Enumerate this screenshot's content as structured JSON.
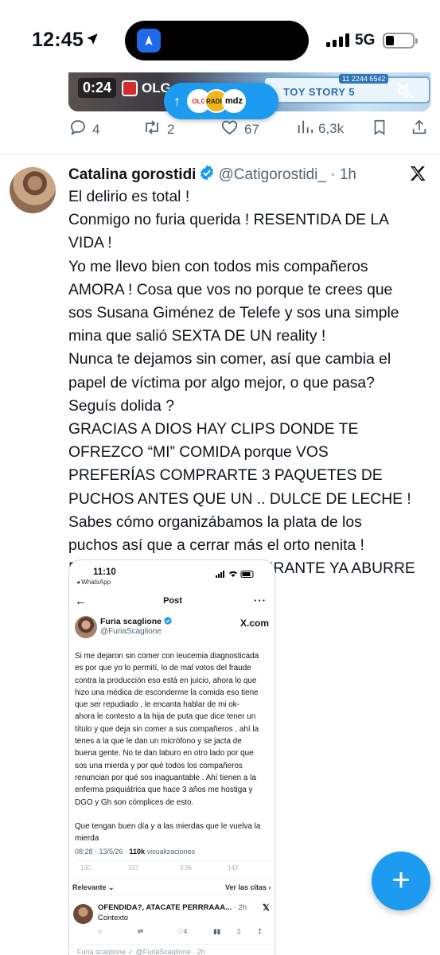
{
  "status_bar": {
    "time": "12:45",
    "network": "5G",
    "battery_level": 0.3
  },
  "previous_tweet": {
    "video_time": "0:24",
    "video_channel": "OLG",
    "video_overlay_number": "11 2244 6542",
    "video_banner": "TOY STORY 5",
    "new_posts_avatars": [
      "OLG",
      "RADIO",
      "mdz"
    ],
    "replies": "4",
    "reposts": "2",
    "likes": "67",
    "views": "6,3k"
  },
  "tweet": {
    "author_name": "Catalina gorostidi",
    "handle": "@Catigorostidi_",
    "time": "· 1h",
    "lines": [
      "El delirio es total !",
      "Conmigo no furia querida ! RESENTIDA DE LA",
      "VIDA !",
      "Yo me llevo bien con todos mis compañeros",
      "AMORA ! Cosa que vos no porque te crees que",
      "sos Susana Giménez de Telefe y sos una simple",
      "mina que salió SEXTA DE UN reality !",
      "Nunca te dejamos sin comer, así que cambia el",
      "papel de víctima por algo mejor, o que pasa?",
      "Seguís dolida ?",
      "GRACIAS A DIOS HAY CLIPS DONDE TE",
      "OFREZCO “MI” COMIDA porque VOS",
      "PREFERÍAS COMPRARTE 3 PAQUETES DE",
      "PUCHOS ANTES QUE UN .. DULCE DE LECHE !",
      "Sabes cómo organizábamos la plata de los",
      "puchos así que a cerrar más el orto nenita !",
      "PORQUE EL PAPEL DE DELIRANTE YA ABURRE"
    ]
  },
  "embedded_screenshot": {
    "time": "11:10",
    "back_app": "◂ WhatsApp",
    "header_title": "Post",
    "author_name": "Furia scaglione",
    "handle": "@FuriaScaglione",
    "xcom": "X.com",
    "text_lines": [
      "Si me dejaron sin comer con leucemia diagnosticada",
      "es por que yo lo permití, lo de mal votos del fraude",
      "contra la producción eso está en juicio, ahora lo que",
      "hizo una médica de esconderme la comida eso tiene",
      "que ser repudiado , le encanta hablar de mi ok-",
      "ahora le contesto a la hija de puta que dice tener un",
      "título y que deja sin comer a sus compañeros , ahí la",
      "tenes a la que le dan un micrófono y se jacta de",
      "buena gente. No te dan laburo en otro lado por que",
      "sos una mierda y por qué todos los compañeros",
      "renuncian por qué sos inaguantable . Ahí tienen a la",
      "enferma psiquiátrica que hace 3 años me hostiga y",
      "DGO y Gh son cómplices de esto.",
      "",
      "Que tengan buen día y a las mierdas que le vuelva la",
      "mierda"
    ],
    "meta_date": "08:28 · 13/5/26 · ",
    "meta_views_count": "110k",
    "meta_views_label": " visualizaciones",
    "stat_replies": "130",
    "stat_reposts": "337",
    "stat_likes": "3,9k",
    "stat_bookmarks": "142",
    "relevant_label": "Relevante ⌄",
    "quotes_label": "Ver las citas ›",
    "reply_author": "OFENDIDA?, ATACATE PERRRAAA...",
    "reply_time": " · 2h",
    "reply_text": "Contexto",
    "reply_likes": "4",
    "next_reply": "Furia scaglione ✓ @FuriaScaglione · 2h"
  },
  "colors": {
    "accent": "#1d9bf0",
    "secondary_text": "#536471"
  }
}
